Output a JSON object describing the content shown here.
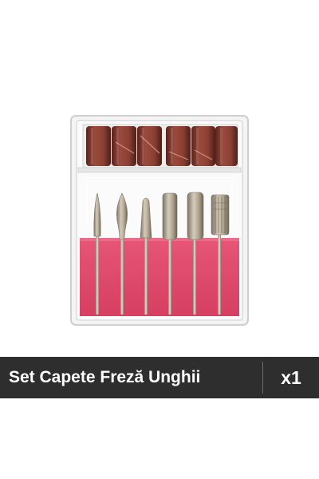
{
  "product_image": {
    "alt_icon": "nail-drill-bit-set-photo",
    "colors": {
      "sanding_band": "#8a3f33",
      "pink_foam": "#e04b6b",
      "metal": "#b7ab98",
      "case_frame": "#e8e8e8"
    }
  },
  "label_bar": {
    "title": "Set Capete Freză Unghii",
    "quantity": "x1",
    "colors": {
      "background": "#2e2e2e",
      "text": "#ffffff"
    }
  }
}
